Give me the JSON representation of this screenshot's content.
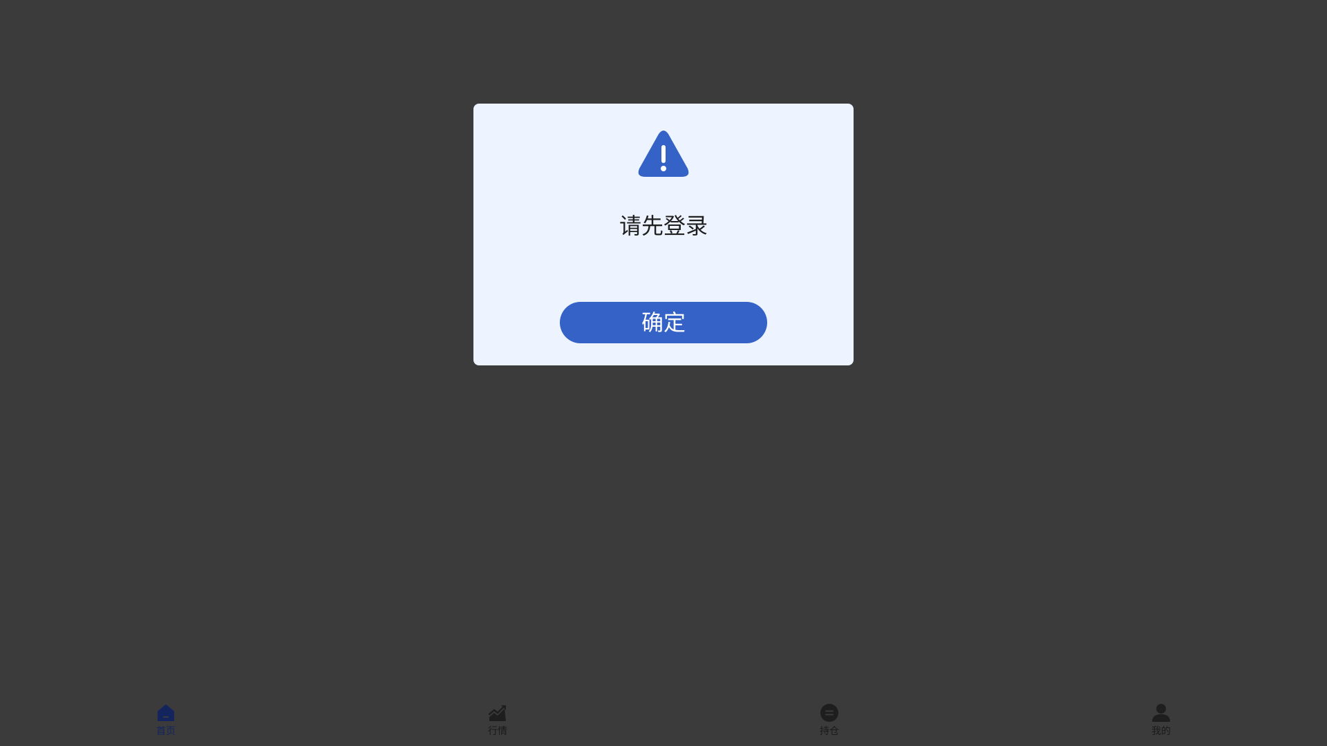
{
  "modal": {
    "icon": "warning-triangle-icon",
    "message": "请先登录",
    "confirm_label": "确定"
  },
  "tabbar": {
    "items": [
      {
        "label": "首页",
        "icon": "home-icon",
        "active": true
      },
      {
        "label": "行情",
        "icon": "trend-chart-icon",
        "active": false
      },
      {
        "label": "持仓",
        "icon": "position-circle-icon",
        "active": false
      },
      {
        "label": "我的",
        "icon": "user-icon",
        "active": false
      }
    ]
  },
  "colors": {
    "overlay_background": "#3b3b3b",
    "modal_background": "#eef4ff",
    "accent": "#3462c6",
    "active_tab": "#14245c",
    "inactive_tab": "#1a1a1a"
  }
}
